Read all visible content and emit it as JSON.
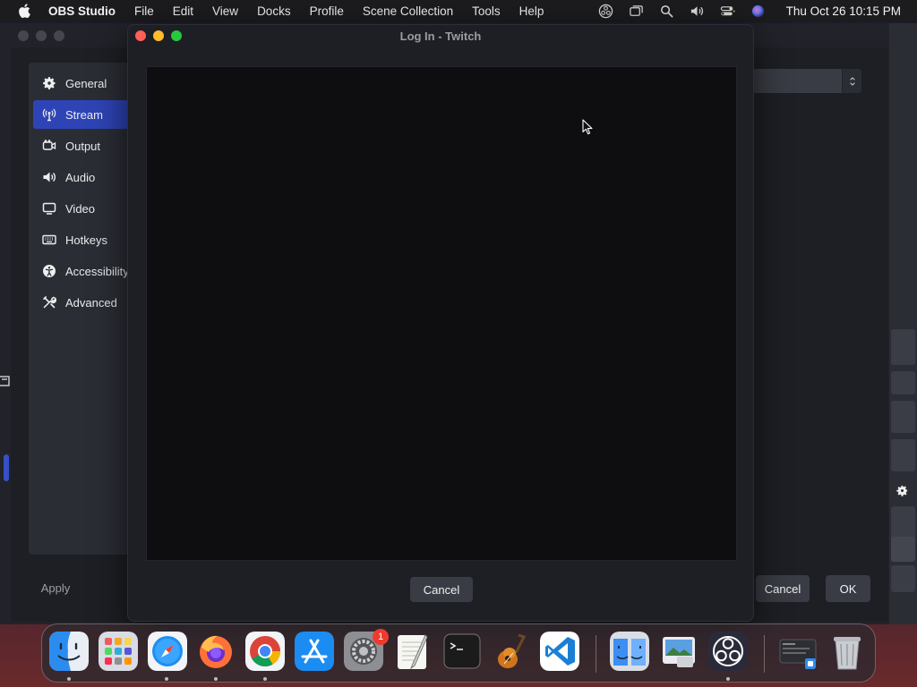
{
  "menubar": {
    "app_name": "OBS Studio",
    "items": [
      "File",
      "Edit",
      "View",
      "Docks",
      "Profile",
      "Scene Collection",
      "Tools",
      "Help"
    ],
    "status_icons": [
      "obs-tray-icon",
      "screen-mirroring-icon",
      "spotlight-search-icon",
      "volume-icon",
      "control-center-icon",
      "siri-icon"
    ],
    "clock": "Thu Oct 26  10:15 PM"
  },
  "settings": {
    "nav": [
      {
        "label": "General",
        "icon": "gear-icon",
        "active": false
      },
      {
        "label": "Stream",
        "icon": "antenna-icon",
        "active": true
      },
      {
        "label": "Output",
        "icon": "output-icon",
        "active": false
      },
      {
        "label": "Audio",
        "icon": "speaker-icon",
        "active": false
      },
      {
        "label": "Video",
        "icon": "monitor-icon",
        "active": false
      },
      {
        "label": "Hotkeys",
        "icon": "keyboard-icon",
        "active": false
      },
      {
        "label": "Accessibility",
        "icon": "accessibility-icon",
        "active": false
      },
      {
        "label": "Advanced",
        "icon": "tools-icon",
        "active": false
      }
    ],
    "apply_label": "Apply",
    "cancel_label": "Cancel",
    "ok_label": "OK"
  },
  "dialog": {
    "title": "Log In - Twitch",
    "cancel_label": "Cancel"
  },
  "dock": {
    "apps": [
      {
        "name": "finder-icon",
        "running": true
      },
      {
        "name": "launchpad-icon",
        "running": false
      },
      {
        "name": "safari-icon",
        "running": true
      },
      {
        "name": "firefox-icon",
        "running": true
      },
      {
        "name": "chrome-icon",
        "running": true
      },
      {
        "name": "app-store-icon",
        "running": false
      },
      {
        "name": "system-settings-icon",
        "running": false,
        "badge": "1"
      },
      {
        "name": "textedit-icon",
        "running": false
      },
      {
        "name": "terminal-icon",
        "running": false
      },
      {
        "name": "garageband-icon",
        "running": false
      },
      {
        "name": "vscode-icon",
        "running": false
      },
      {
        "name": "migration-assistant-icon",
        "running": false
      },
      {
        "name": "preview-icon",
        "running": false
      },
      {
        "name": "obs-icon",
        "running": true
      },
      {
        "name": "downloads-stack-icon",
        "running": false
      },
      {
        "name": "trash-icon",
        "running": false
      }
    ]
  },
  "colors": {
    "accent": "#2e44b6",
    "window_bg": "#1e1f24",
    "sidebar_bg": "#2b2d35",
    "webview_bg": "#0e0e10",
    "close": "#fe5f57",
    "minimize": "#febc2e",
    "zoom": "#28c840",
    "badge": "#f03a2e"
  }
}
